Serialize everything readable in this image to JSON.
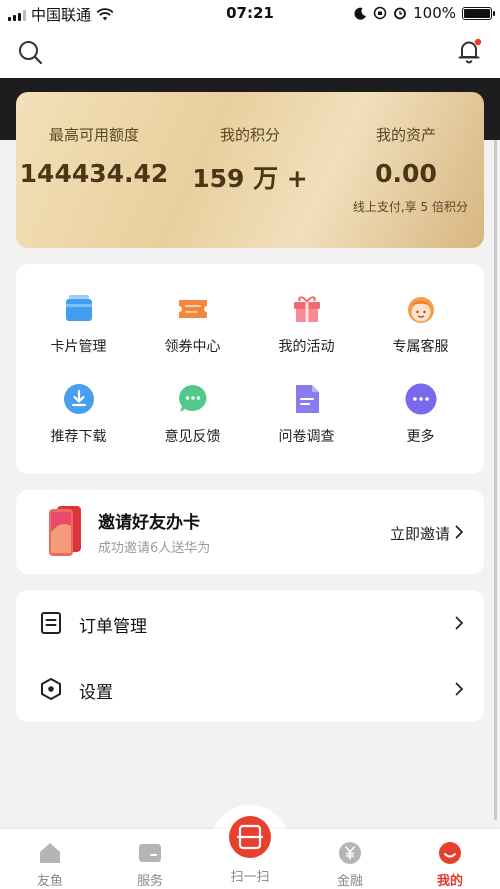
{
  "status_bar": {
    "carrier": "中国联通",
    "time": "07:21",
    "battery": "100%"
  },
  "assets": {
    "credit_label": "最高可用额度",
    "credit_value": "144434.42",
    "points_label": "我的积分",
    "points_value": "159 万 +",
    "assets_label": "我的资产",
    "assets_value": "0.00",
    "note": "线上支付,享 5 倍积分"
  },
  "grid": {
    "items": [
      {
        "label": "卡片管理",
        "icon": "card-icon"
      },
      {
        "label": "领券中心",
        "icon": "coupon-icon"
      },
      {
        "label": "我的活动",
        "icon": "gift-icon"
      },
      {
        "label": "专属客服",
        "icon": "service-agent-icon"
      },
      {
        "label": "推荐下载",
        "icon": "download-icon"
      },
      {
        "label": "意见反馈",
        "icon": "chat-bubble-icon"
      },
      {
        "label": "问卷调查",
        "icon": "document-icon"
      },
      {
        "label": "更多",
        "icon": "more-icon"
      }
    ]
  },
  "invite": {
    "title": "邀请好友办卡",
    "subtitle": "成功邀请6人送华为",
    "action": "立即邀请"
  },
  "menu": {
    "orders": "订单管理",
    "settings": "设置"
  },
  "tabs": {
    "items": [
      {
        "label": "友鱼",
        "icon": "home-icon"
      },
      {
        "label": "服务",
        "icon": "service-icon"
      },
      {
        "label": "扫一扫",
        "icon": "scan-icon"
      },
      {
        "label": "金融",
        "icon": "yuan-icon"
      },
      {
        "label": "我的",
        "icon": "profile-icon"
      }
    ],
    "active": "我的"
  },
  "colors": {
    "accent": "#e8402f",
    "gold_text": "#4a3718",
    "dark_band": "#1d1d1f"
  }
}
